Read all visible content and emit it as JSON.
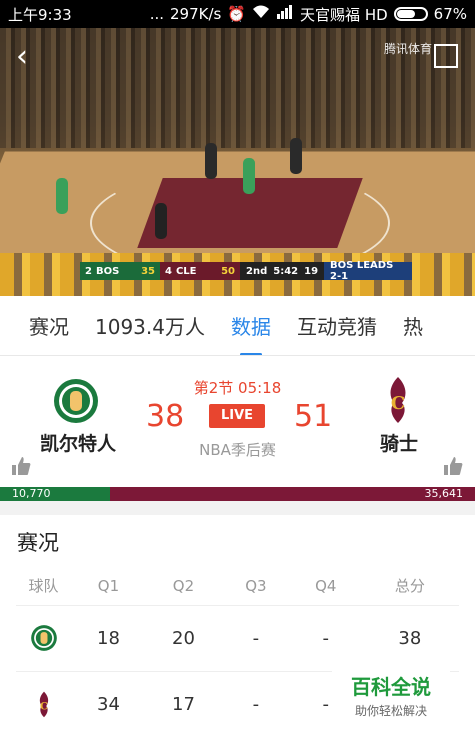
{
  "status_bar": {
    "time": "上午9:33",
    "dots": "...",
    "speed": "297K/s",
    "carrier": "天官赐福 HD",
    "battery": "67%",
    "battery_level": 0.67
  },
  "video": {
    "watermark": "腾讯体育",
    "scorebug": {
      "away_team": "BOS",
      "away_seed": "2",
      "away_score": "35",
      "home_team": "CLE",
      "home_seed": "4",
      "home_score": "50",
      "period": "2nd",
      "clock": "5:42",
      "shot_clock": "19",
      "series_note": "BOS LEADS 2-1"
    }
  },
  "tabs": [
    "赛况",
    "1093.4万人",
    "数据",
    "互动竞猜",
    "热"
  ],
  "active_tab_index": 2,
  "match": {
    "away": {
      "name": "凯尔特人",
      "score": "38",
      "color": "#1b7a3e"
    },
    "home": {
      "name": "骑士",
      "score": "51",
      "color": "#7c1837"
    },
    "period": "第2节 05:18",
    "live_label": "LIVE",
    "league": "NBA季后赛"
  },
  "votes": {
    "away": "10,770",
    "home": "35,641"
  },
  "stats": {
    "title": "赛况",
    "headers": [
      "球队",
      "Q1",
      "Q2",
      "Q3",
      "Q4",
      "总分"
    ],
    "rows": [
      {
        "team": "celtics",
        "q1": "18",
        "q2": "20",
        "q3": "-",
        "q4": "-",
        "total": "38"
      },
      {
        "team": "cavaliers",
        "q1": "34",
        "q2": "17",
        "q3": "-",
        "q4": "-",
        "total": ""
      }
    ]
  },
  "brand": {
    "title": "百科全说",
    "subtitle": "助你轻松解决"
  },
  "colors": {
    "accent": "#2a86e8",
    "live": "#e8452f"
  }
}
